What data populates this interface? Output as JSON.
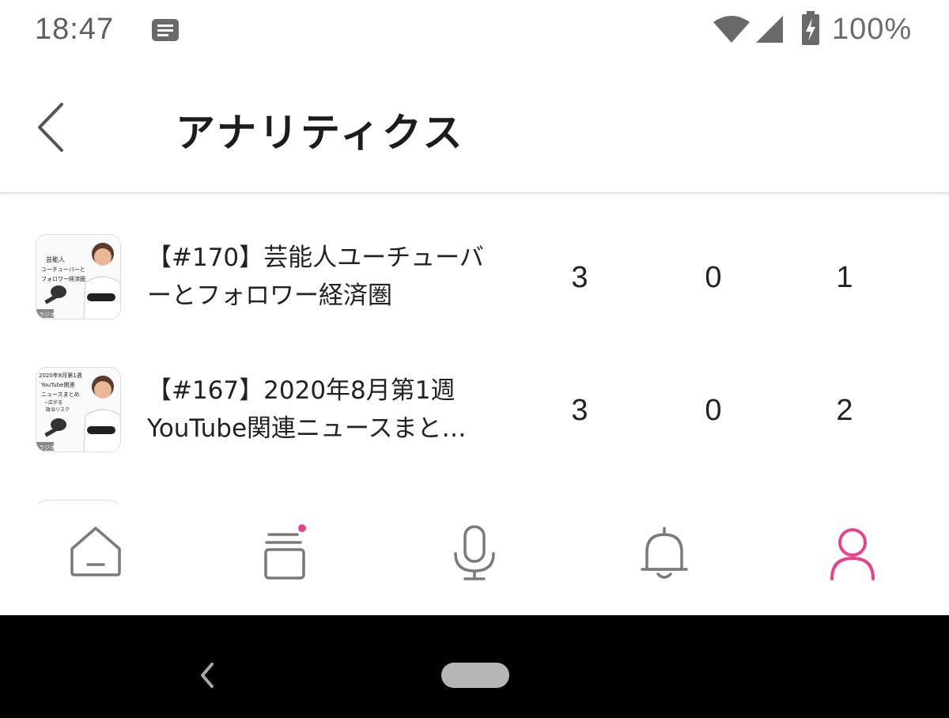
{
  "status_bar": {
    "time": "18:47",
    "battery": "100%",
    "icons": [
      "notification-icon",
      "wifi-icon",
      "signal-icon",
      "battery-charging-icon"
    ]
  },
  "header": {
    "title": "アナリティクス",
    "back_icon": "chevron-left-icon"
  },
  "episodes": [
    {
      "title_line1": "【#170】芸能人ユーチューバ",
      "title_line2": "ーとフォロワー経済圏",
      "stat1": "3",
      "stat2": "0",
      "stat3": "1",
      "thumb_text": [
        "芸能人",
        "ユーチューバーと",
        "フォロワー経済圏"
      ],
      "thumb_tag": "ラジオ"
    },
    {
      "title_line1": "【#167】2020年8月第1週",
      "title_line2": "YouTube関連ニュースまと…",
      "stat1": "3",
      "stat2": "0",
      "stat3": "2",
      "thumb_text": [
        "2020年8月第1週",
        "YouTube関連",
        "ニュースまとめ",
        "~広がる",
        "政治リスク"
      ],
      "thumb_tag": "ラジオ"
    }
  ],
  "bottom_nav": {
    "items": [
      "home-icon",
      "library-icon",
      "microphone-icon",
      "bell-icon",
      "profile-icon"
    ],
    "active": "profile-icon",
    "accent_color": "#e8438a",
    "inactive_color": "#7a7a7a"
  }
}
